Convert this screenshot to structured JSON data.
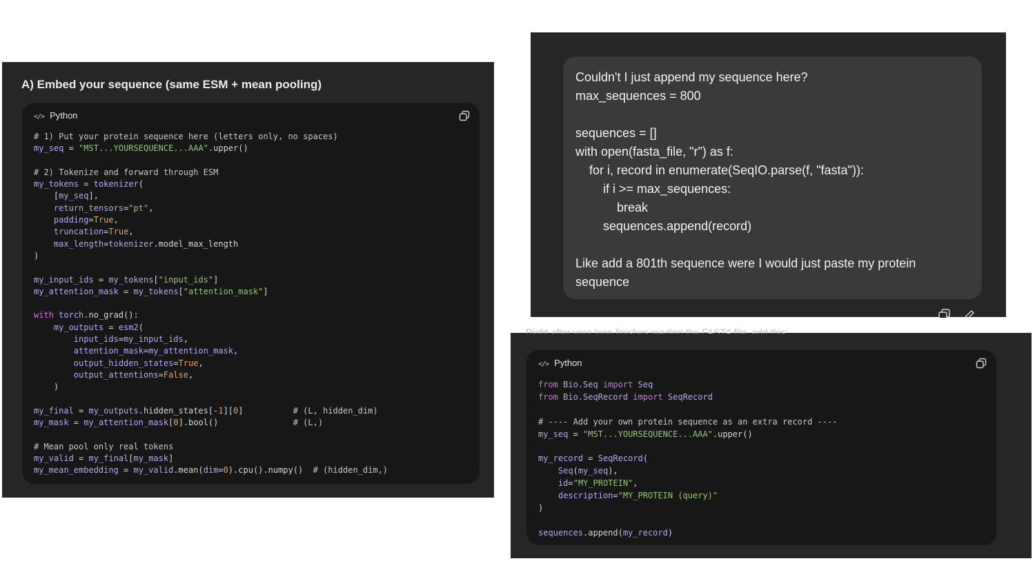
{
  "panel_a": {
    "heading": "A) Embed your sequence (same ESM + mean pooling)",
    "code_lang": "Python",
    "lang_icon": "code-brackets-icon",
    "copy_icon": "copy-icon"
  },
  "panel_b": {
    "message_lines": [
      "Couldn't I just append my sequence here?",
      "max_sequences = 800",
      "",
      "sequences = []",
      "with open(fasta_file, \"r\") as f:",
      "    for i, record in enumerate(SeqIO.parse(f, \"fasta\")):",
      "        if i >= max_sequences:",
      "            break",
      "        sequences.append(record)",
      "",
      "Like add a 801th sequence were I would just paste my protein sequence"
    ],
    "actions": [
      "copy-icon",
      "edit-pencil-icon"
    ]
  },
  "panel_c": {
    "cut_off_text": "Right after your loop finishes reading the FASTA file, add this:",
    "code_lang": "Python",
    "lang_icon": "code-brackets-icon",
    "copy_icon": "copy-icon"
  },
  "colors": {
    "panel_bg": "#262626",
    "code_bg": "#171717",
    "bubble_bg": "#3a3a3a",
    "string": "#98c379",
    "keyword": "#c678dd",
    "number": "#e5a46b"
  }
}
